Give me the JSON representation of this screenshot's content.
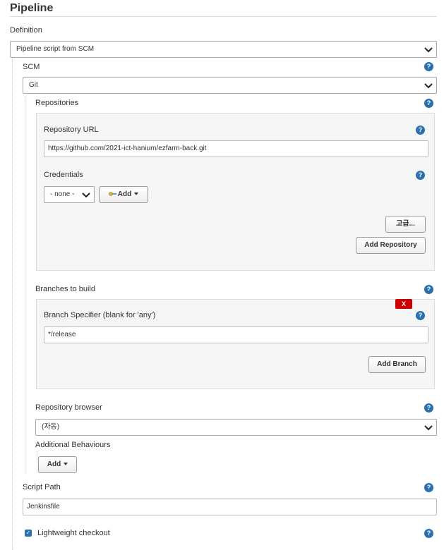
{
  "section": {
    "title": "Pipeline",
    "definition_label": "Definition",
    "definition_value": "Pipeline script from SCM"
  },
  "scm": {
    "label": "SCM",
    "value": "Git"
  },
  "repositories": {
    "label": "Repositories",
    "url_label": "Repository URL",
    "url_value": "https://github.com/2021-ict-hanium/ezfarm-back.git",
    "credentials_label": "Credentials",
    "credentials_value": "- none -",
    "add_label": "Add",
    "advanced_label": "고급...",
    "add_repository_label": "Add Repository"
  },
  "branches": {
    "label": "Branches to build",
    "delete_label": "X",
    "specifier_label": "Branch Specifier (blank for 'any')",
    "specifier_value": "*/release",
    "add_branch_label": "Add Branch"
  },
  "repository_browser": {
    "label": "Repository browser",
    "value": "(자동)"
  },
  "additional_behaviours": {
    "label": "Additional Behaviours",
    "add_label": "Add"
  },
  "script_path": {
    "label": "Script Path",
    "value": "Jenkinsfile"
  },
  "lightweight_checkout": {
    "label": "Lightweight checkout",
    "checked": true
  },
  "help_glyph": "?",
  "checkbox_glyph": "✓",
  "colors": {
    "help_blue": "#2a6fb0",
    "delete_red": "#cc0000",
    "panel_bg": "#f6f6f6",
    "border": "#a8a8a8"
  },
  "icons": {
    "dropdown": "chevron-down-icon",
    "help": "help-icon",
    "credentials": "key-icon",
    "add_menu": "caret-down-icon"
  }
}
